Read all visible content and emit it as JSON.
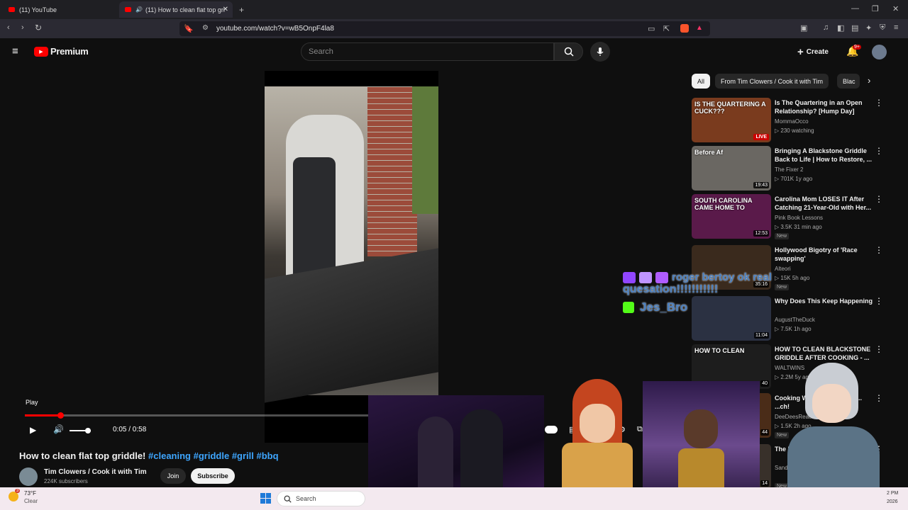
{
  "browser": {
    "tabs": [
      {
        "label": "(11) YouTube",
        "active": false
      },
      {
        "label": "(11) How to clean flat top gri",
        "active": true
      }
    ],
    "url": "youtube.com/watch?v=wB5OnpF4la8"
  },
  "header": {
    "logo_text": "Premium",
    "search_placeholder": "Search",
    "create_label": "Create",
    "notifications_badge": "9+"
  },
  "player": {
    "tooltip": "Play",
    "time": "0:05 / 0:58",
    "progress": 0.086,
    "volume": 0.85
  },
  "video": {
    "title_prefix": "How to clean flat top griddle!",
    "hashtags": [
      "#cleaning",
      "#griddle",
      "#grill",
      "#bbq"
    ],
    "channel": "Tim Clowers / Cook it with Tim",
    "subscribers": "224K subscribers",
    "join_label": "Join",
    "subscribe_label": "Subscribe"
  },
  "chips": [
    "All",
    "From Tim Clowers / Cook it with Tim",
    "Blac"
  ],
  "recommendations": [
    {
      "title": "Is The Quartering in an Open Relationship? [Hump Day]",
      "channel": "MommaOcco",
      "meta": "▷ 230 watching",
      "badge": "LIVE",
      "thumb_color": "#7a3b1e",
      "thumb_text": "IS THE QUARTERING A CUCK???"
    },
    {
      "title": "Bringing A Blackstone Griddle Back to Life | How to Restore, ...",
      "channel": "The Fixer 2",
      "meta": "▷ 701K  1y ago",
      "badge": "19:43",
      "thumb_color": "#6a6762",
      "thumb_text": "Before   Af"
    },
    {
      "title": "Carolina Mom LOSES IT After Catching 21-Year-Old with Her...",
      "channel": "Pink Book Lessons",
      "meta": "▷ 3.5K  31 min ago",
      "badge": "12:53",
      "new": "New",
      "thumb_color": "#5a1a4a",
      "thumb_text": "SOUTH CAROLINA CAME HOME TO"
    },
    {
      "title": "Hollywood Bigotry of 'Race swapping'",
      "channel": "Alteori",
      "meta": "▷ 15K  5h ago",
      "badge": "35:16",
      "new": "New",
      "thumb_color": "#3a2a1d",
      "thumb_text": ""
    },
    {
      "title": "Why Does This Keep Happening",
      "channel": "AugustTheDuck",
      "meta": "▷ 7.5K  1h ago",
      "badge": "11:04",
      "thumb_color": "#2b3142",
      "thumb_text": ""
    },
    {
      "title": "HOW TO CLEAN BLACKSTONE GRIDDLE AFTER COOKING - ...",
      "channel": "WALTWINS",
      "meta": "▷ 2.2M  5y ago",
      "badge": "40",
      "thumb_color": "#1d1d1d",
      "thumb_text": "HOW TO CLEAN"
    },
    {
      "title": "Cooking W... is GETTING H... ...ch!",
      "channel": "DeeDeesReac...",
      "meta": "▷ 1.5K  2h ago",
      "badge": "44",
      "new": "New",
      "thumb_color": "#4a2c18",
      "thumb_text": ""
    },
    {
      "title": "The Re... Degre...",
      "channel": "Sandr...",
      "meta": "",
      "badge": "14",
      "new": "New",
      "thumb_color": "#38302a",
      "thumb_text": ""
    }
  ],
  "chat_overlay": {
    "line1": "roger bertoy ok real",
    "line2": "quesation!!!!!!!!!!!",
    "line3": "Jes_Bro"
  },
  "taskbar": {
    "temperature": "73°F",
    "condition": "Clear",
    "search_label": "Search",
    "weather_badge": "3",
    "clock_fragment": "2 PM",
    "date_fragment": "2026"
  }
}
